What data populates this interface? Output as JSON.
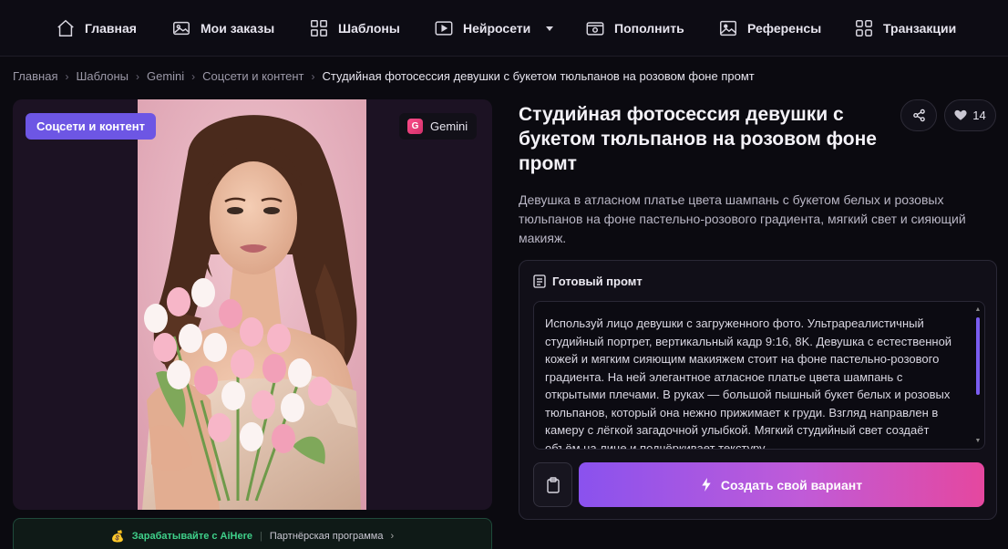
{
  "nav": {
    "items": [
      {
        "label": "Главная",
        "icon": "home-icon"
      },
      {
        "label": "Мои заказы",
        "icon": "image-gallery-icon"
      },
      {
        "label": "Шаблоны",
        "icon": "grid-icon"
      },
      {
        "label": "Нейросети",
        "icon": "play-icon"
      },
      {
        "label": "Пополнить",
        "icon": "wallet-icon"
      },
      {
        "label": "Референсы",
        "icon": "picture-icon"
      },
      {
        "label": "Транзакции",
        "icon": "grid-icon"
      }
    ]
  },
  "breadcrumb": {
    "items": [
      "Главная",
      "Шаблоны",
      "Gemini",
      "Соцсети и контент"
    ],
    "current": "Студийная фотосессия девушки с букетом тюльпанов на розовом фоне промт"
  },
  "media": {
    "category_badge": "Соцсети и контент",
    "model_letter": "G",
    "model_badge": "Gemini"
  },
  "partner": {
    "earn_label": "Зарабатывайте с AiHere",
    "program_label": "Партнёрская программа"
  },
  "detail": {
    "title": "Студийная фотосессия девушки с букетом тюльпанов на розовом фоне промт",
    "likes": "14",
    "description": "Девушка в атласном платье цвета шампань с букетом белых и розовых тюльпанов на фоне пастельно-розового градиента, мягкий свет и сияющий макияж."
  },
  "prompt": {
    "heading": "Готовый промт",
    "text": "Используй лицо девушки с загруженного фото. Ультрареалистичный студийный портрет, вертикальный кадр 9:16, 8K. Девушка с естественной кожей и мягким сияющим макияжем стоит на фоне пастельно-розового градиента. На ней элегантное атласное платье цвета шампань с открытыми плечами. В руках — большой пышный букет белых и розовых тюльпанов, который она нежно прижимает к груди. Взгляд направлен в камеру с лёгкой загадочной улыбкой. Мягкий студийный свет создаёт объём на лице и подчёркивает текстуру",
    "create_label": "Создать свой вариант"
  },
  "colors": {
    "accent_purple": "#6d56e4",
    "gradient_start": "#8a52ee",
    "gradient_end": "#e5479f",
    "partner_green": "#3fd08a"
  }
}
